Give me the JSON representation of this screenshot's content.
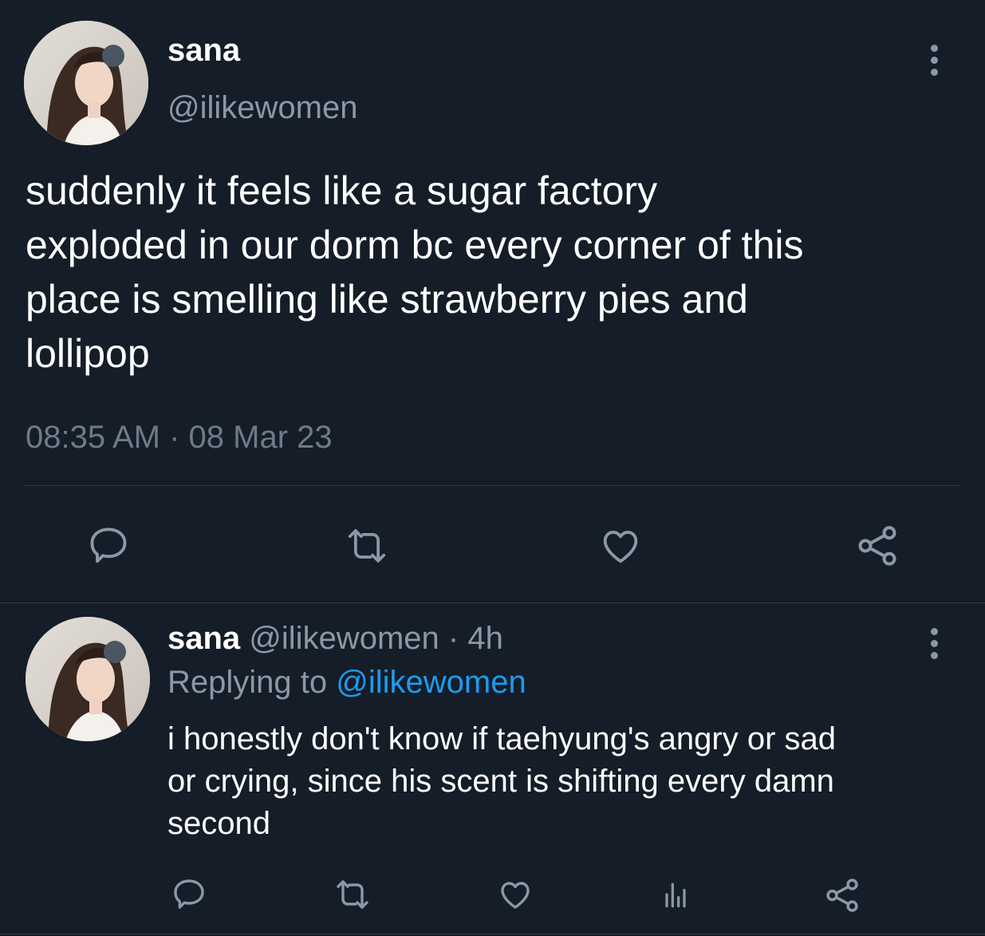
{
  "tweet": {
    "display_name": "sana",
    "handle": "@ilikewomen",
    "text": "suddenly it feels like a sugar factory\nexploded in our dorm bc every corner of this\nplace is smelling like strawberry pies and\nlollipop",
    "timestamp": "08:35 AM · 08 Mar 23",
    "actions": [
      "reply-icon",
      "retweet-icon",
      "like-icon",
      "share-icon"
    ]
  },
  "reply": {
    "display_name": "sana",
    "handle": "@ilikewomen",
    "separator": "·",
    "age": "4h",
    "replying_prefix": "Replying to",
    "replying_to": "@ilikewomen",
    "text": "i honestly don't know if taehyung's angry or sad\nor crying, since his scent is shifting every damn\nsecond",
    "actions": [
      "reply-icon",
      "retweet-icon",
      "like-icon",
      "analytics-icon",
      "share-icon"
    ]
  },
  "colors": {
    "background": "#151d28",
    "text": "#ffffff",
    "muted": "#8b98a5",
    "timestamp": "#6e7b87",
    "divider": "#2f3b47",
    "link": "#1d9bf0"
  }
}
